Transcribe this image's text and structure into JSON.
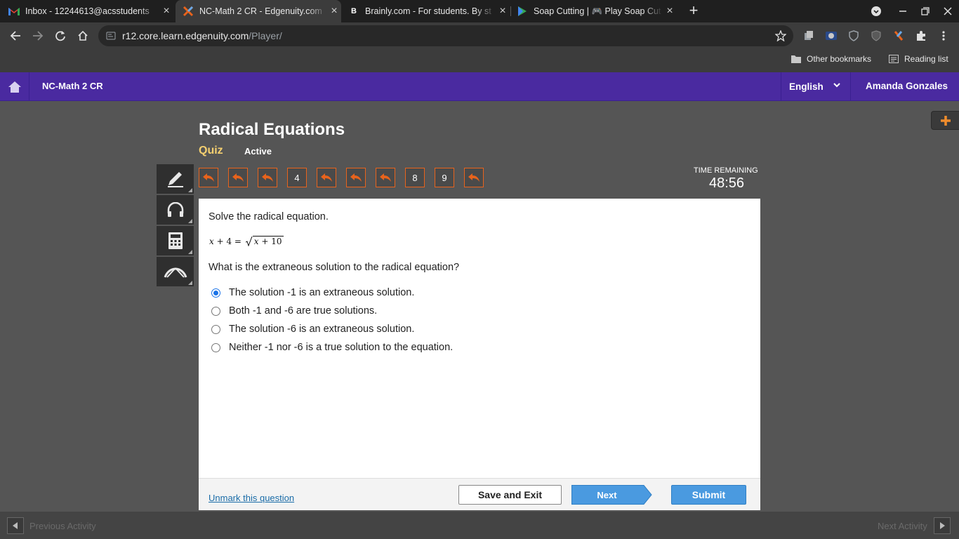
{
  "browser": {
    "tabs": [
      {
        "title": "Inbox - 12244613@acsstudents",
        "icon": "gmail-icon",
        "active": false
      },
      {
        "title": "NC-Math 2 CR - Edgenuity.com",
        "icon": "edgenuity-icon",
        "active": true
      },
      {
        "title": "Brainly.com - For students. By st",
        "icon": "brainly-icon",
        "active": false
      },
      {
        "title": "Soap Cutting | 🎮 Play Soap Cut",
        "icon": "play-icon",
        "active": false
      }
    ],
    "url_host": "r12.core.learn.edgenuity.com",
    "url_path": "/Player/",
    "bookmarks": {
      "other": "Other bookmarks",
      "reading_list": "Reading list"
    }
  },
  "header": {
    "course": "NC-Math 2 CR",
    "language": "English",
    "user": "Amanda Gonzales"
  },
  "lesson": {
    "title": "Radical Equations",
    "type": "Quiz",
    "status": "Active"
  },
  "timer": {
    "label": "TIME REMAINING",
    "value": "48:56"
  },
  "question_nav": [
    {
      "label": "",
      "marked": true
    },
    {
      "label": "",
      "marked": true
    },
    {
      "label": "",
      "marked": true
    },
    {
      "label": "4",
      "marked": false
    },
    {
      "label": "",
      "marked": true
    },
    {
      "label": "",
      "marked": true
    },
    {
      "label": "",
      "marked": true
    },
    {
      "label": "8",
      "marked": false
    },
    {
      "label": "9",
      "marked": false
    },
    {
      "label": "",
      "marked": true
    }
  ],
  "question": {
    "prompt": "Solve the radical equation.",
    "equation_lhs_var": "x",
    "equation_lhs_rest": " + 4 = ",
    "equation_radicand_var": "x",
    "equation_radicand_rest": " + 10",
    "text": "What is the extraneous solution to the radical equation?",
    "options": [
      {
        "label": "The solution -1 is an extraneous solution.",
        "selected": true
      },
      {
        "label": "Both -1 and -6 are true solutions.",
        "selected": false
      },
      {
        "label": "The solution -6 is an extraneous solution.",
        "selected": false
      },
      {
        "label": "Neither -1 nor -6 is a true solution to the equation.",
        "selected": false
      }
    ]
  },
  "footer": {
    "unmark": "Unmark this question",
    "save_exit": "Save and Exit",
    "next": "Next",
    "submit": "Submit"
  },
  "activity": {
    "previous": "Previous Activity",
    "next": "Next Activity"
  },
  "colors": {
    "header_bg": "#4a2aa0",
    "accent_orange": "#e8631c",
    "quiz_gold": "#f5d070",
    "button_blue": "#4a9ae0"
  }
}
